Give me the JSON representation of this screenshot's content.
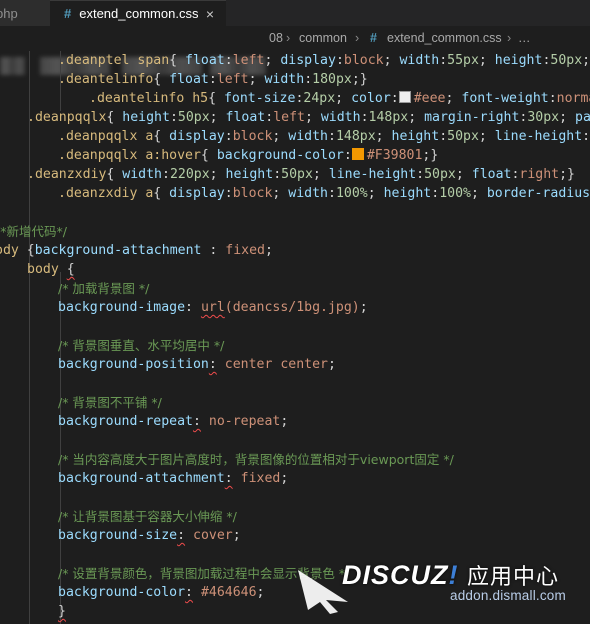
{
  "tabs": [
    {
      "label": "php",
      "active": false
    },
    {
      "label": "extend_common.css",
      "active": true,
      "close_glyph": "×"
    }
  ],
  "breadcrumb": {
    "segment1": "08",
    "segment2": "common",
    "file": "extend_common.css",
    "tail": "…",
    "separator": "›"
  },
  "colors": {
    "swatch_eee": "#eeeeee",
    "swatch_f39801": "#F39801",
    "editor_bg": "#1e1e1e"
  },
  "watermark": {
    "main_white": "DISCUZ",
    "main_blue": "!",
    "main_cn": "应用中心",
    "sub": "addon.dismall.com"
  }
}
